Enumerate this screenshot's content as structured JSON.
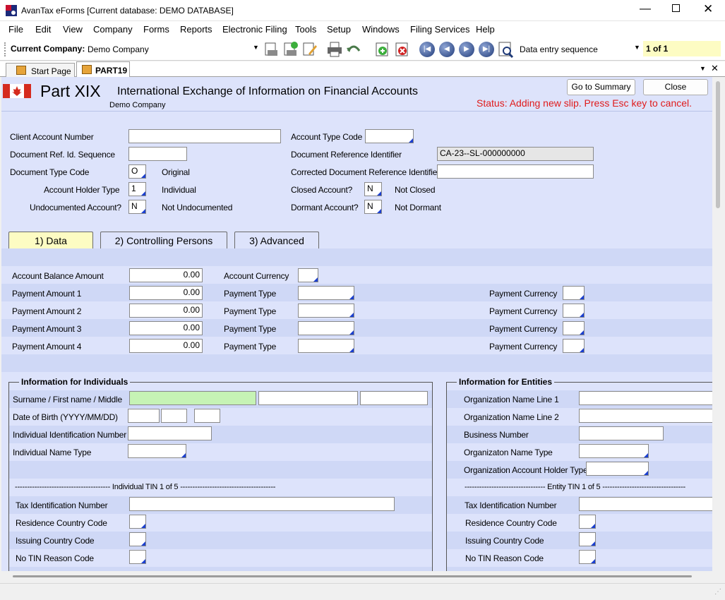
{
  "window": {
    "title": "AvanTax eForms [Current database: DEMO DATABASE]"
  },
  "menu": [
    "File",
    "Edit",
    "View",
    "Company",
    "Forms",
    "Reports",
    "Electronic Filing",
    "Tools",
    "Setup",
    "Windows",
    "Filing Services",
    "Help"
  ],
  "toolbar": {
    "company_label": "Current Company:",
    "company_value": "Demo Company",
    "sequence_value": "Data entry sequence",
    "record_count": "1 of 1",
    "record_count_bg": "#fdfcc3"
  },
  "tabs": {
    "start": "Start Page",
    "part": "PART19"
  },
  "form": {
    "part_title": "Part XIX",
    "subtitle": "International Exchange of Information on Financial Accounts",
    "company": "Demo Company",
    "status": "Status: Adding new slip. Press Esc key to cancel.",
    "status_color": "#e01b1b",
    "summary_btn": "Go to Summary",
    "close_btn": "Close"
  },
  "header": {
    "client_account_number": {
      "label": "Client Account Number",
      "value": ""
    },
    "account_type_code": {
      "label": "Account Type Code",
      "value": ""
    },
    "doc_ref_id_seq": {
      "label": "Document Ref. Id. Sequence",
      "value": ""
    },
    "doc_ref_id": {
      "label": "Document Reference Identifier",
      "value": "CA-23--SL-000000000"
    },
    "doc_type_code": {
      "label": "Document Type Code",
      "value": "O",
      "desc": "Original"
    },
    "corrected_doc_ref": {
      "label": "Corrected Document Reference Identifier",
      "value": ""
    },
    "account_holder_type": {
      "label": "Account Holder Type",
      "value": "1",
      "desc": "Individual"
    },
    "closed_account": {
      "label": "Closed Account?",
      "value": "N",
      "desc": "Not Closed"
    },
    "undocumented": {
      "label": "Undocumented Account?",
      "value": "N",
      "desc": "Not Undocumented"
    },
    "dormant": {
      "label": "Dormant Account?",
      "value": "N",
      "desc": "Not Dormant"
    }
  },
  "subtabs": [
    "1) Data",
    "2) Controlling Persons",
    "3) Advanced"
  ],
  "data": {
    "balance": {
      "label": "Account Balance Amount",
      "value": "0.00"
    },
    "currency_label": "Account Currency",
    "payments": [
      {
        "label": "Payment Amount 1",
        "value": "0.00"
      },
      {
        "label": "Payment Amount 2",
        "value": "0.00"
      },
      {
        "label": "Payment Amount 3",
        "value": "0.00"
      },
      {
        "label": "Payment Amount 4",
        "value": "0.00"
      }
    ],
    "payment_type_label": "Payment Type",
    "payment_currency_label": "Payment Currency"
  },
  "individuals": {
    "title": "Information for Individuals",
    "name_label": "Surname / First name / Middle",
    "dob_label": "Date of Birth  (YYYY/MM/DD)",
    "id_number_label": "Individual Identification Number",
    "name_type_label": "Individual Name Type",
    "tin_header": "--------------------------------------- Individual TIN 1 of 5 ---------------------------------------",
    "tin_label": "Tax Identification Number",
    "residence_label": "Residence Country Code",
    "issuing_label": "Issuing Country Code",
    "no_tin_label": "No TIN Reason Code"
  },
  "entities": {
    "title": "Information for Entities",
    "org_line1_label": "Organization Name Line 1",
    "org_line2_label": "Organization Name Line 2",
    "business_number_label": "Business Number",
    "org_name_type_label": "Organizaton Name Type",
    "org_holder_type_label": "Organization Account Holder Type",
    "tin_header": "--------------------------------- Entity TIN 1 of 5 ----------------------------------",
    "tin_label": "Tax Identification Number",
    "residence_label": "Residence Country Code",
    "issuing_label": "Issuing Country Code",
    "no_tin_label": "No TIN Reason Code"
  }
}
